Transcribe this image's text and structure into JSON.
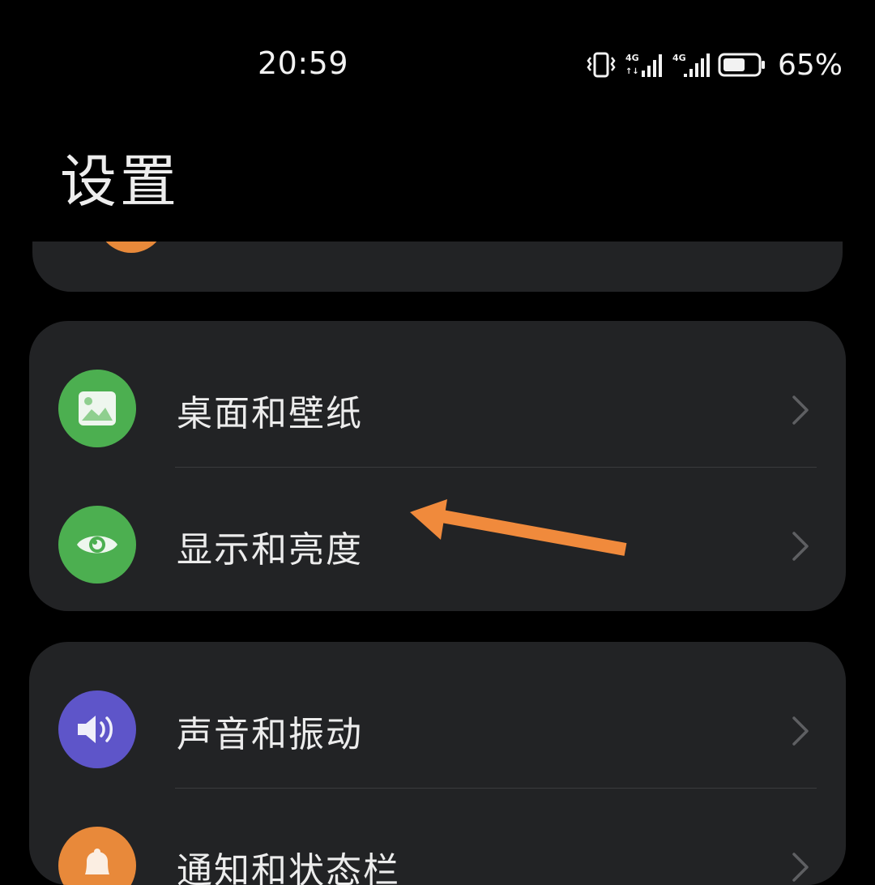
{
  "status_bar": {
    "time": "20:59",
    "battery_percent": "65%",
    "battery_level": 0.65,
    "network_1": "4G",
    "network_2": "4G",
    "icons": [
      "vibrate-icon",
      "signal-4g-icon",
      "signal-4g-icon",
      "battery-icon"
    ]
  },
  "page": {
    "title": "设置"
  },
  "sections": [
    {
      "items": [
        {
          "label": "桌面和壁纸",
          "icon": "wallpaper-icon",
          "icon_color": "#4caf50"
        },
        {
          "label": "显示和亮度",
          "icon": "eye-icon",
          "icon_color": "#4caf50"
        }
      ]
    },
    {
      "items": [
        {
          "label": "声音和振动",
          "icon": "speaker-icon",
          "icon_color": "#6a5acd"
        },
        {
          "label": "通知和状态栏",
          "icon": "bell-icon",
          "icon_color": "#e8893a"
        }
      ]
    }
  ],
  "colors": {
    "background": "#000000",
    "card": "#222325",
    "annotation_arrow": "#f08a3c",
    "green": "#4caf50",
    "purple": "#5e55c9",
    "orange": "#e8893a"
  }
}
